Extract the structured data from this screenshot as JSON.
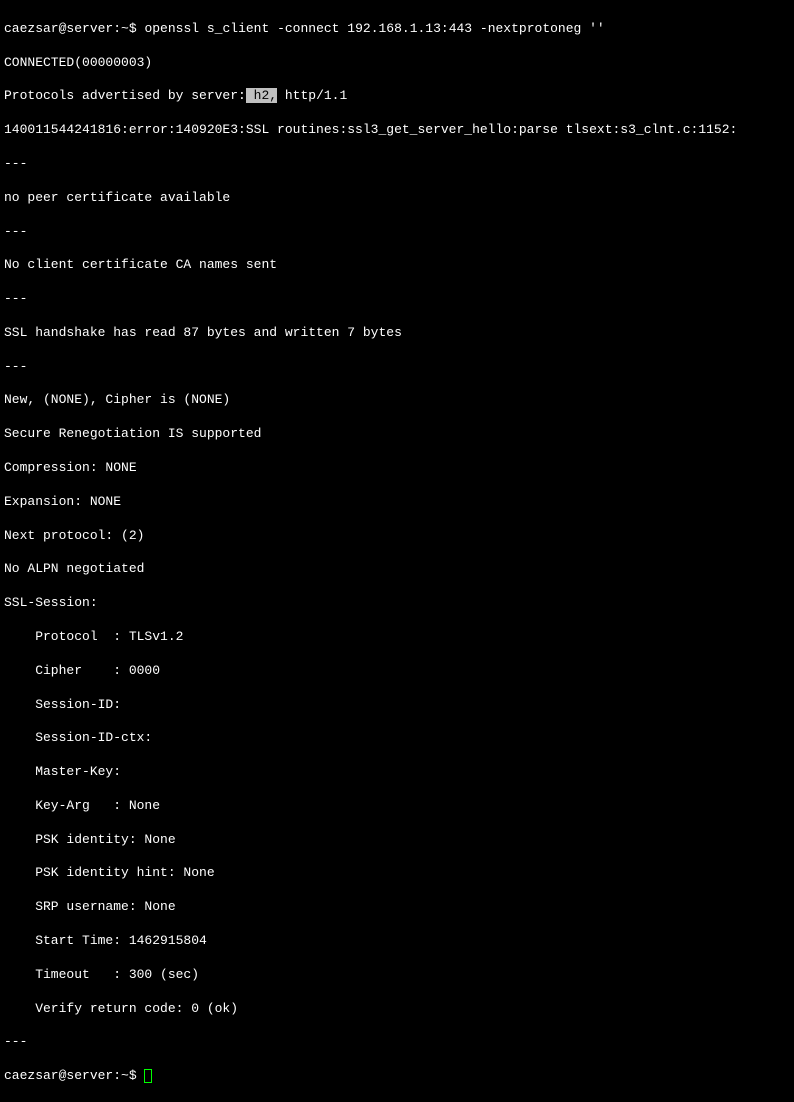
{
  "prompt1": {
    "user": "caezsar",
    "at": "@",
    "host": "server",
    "path": ":~$ ",
    "command": "openssl s_client -connect 192.168.1.13:443 -nextprotoneg ''"
  },
  "output": {
    "line1": "CONNECTED(00000003)",
    "line2_prefix": "Protocols advertised by server:",
    "line2_highlighted": " h2,",
    "line2_suffix": " http/1.1",
    "line3": "140011544241816:error:140920E3:SSL routines:ssl3_get_server_hello:parse tlsext:s3_clnt.c:1152:",
    "sep1": "---",
    "line4": "no peer certificate available",
    "sep2": "---",
    "line5": "No client certificate CA names sent",
    "sep3": "---",
    "line6": "SSL handshake has read 87 bytes and written 7 bytes",
    "sep4": "---",
    "line7": "New, (NONE), Cipher is (NONE)",
    "line8": "Secure Renegotiation IS supported",
    "line9": "Compression: NONE",
    "line10": "Expansion: NONE",
    "line11": "Next protocol: (2)",
    "line12": "No ALPN negotiated",
    "line13": "SSL-Session:",
    "line14": "    Protocol  : TLSv1.2",
    "line15": "    Cipher    : 0000",
    "line16": "    Session-ID:",
    "line17": "    Session-ID-ctx:",
    "line18": "    Master-Key:",
    "line19": "    Key-Arg   : None",
    "line20": "    PSK identity: None",
    "line21": "    PSK identity hint: None",
    "line22": "    SRP username: None",
    "line23": "    Start Time: 1462915804",
    "line24": "    Timeout   : 300 (sec)",
    "line25": "    Verify return code: 0 (ok)",
    "sep5": "---"
  },
  "prompt2": {
    "user": "caezsar",
    "at": "@",
    "host": "server",
    "path": ":~$ "
  }
}
